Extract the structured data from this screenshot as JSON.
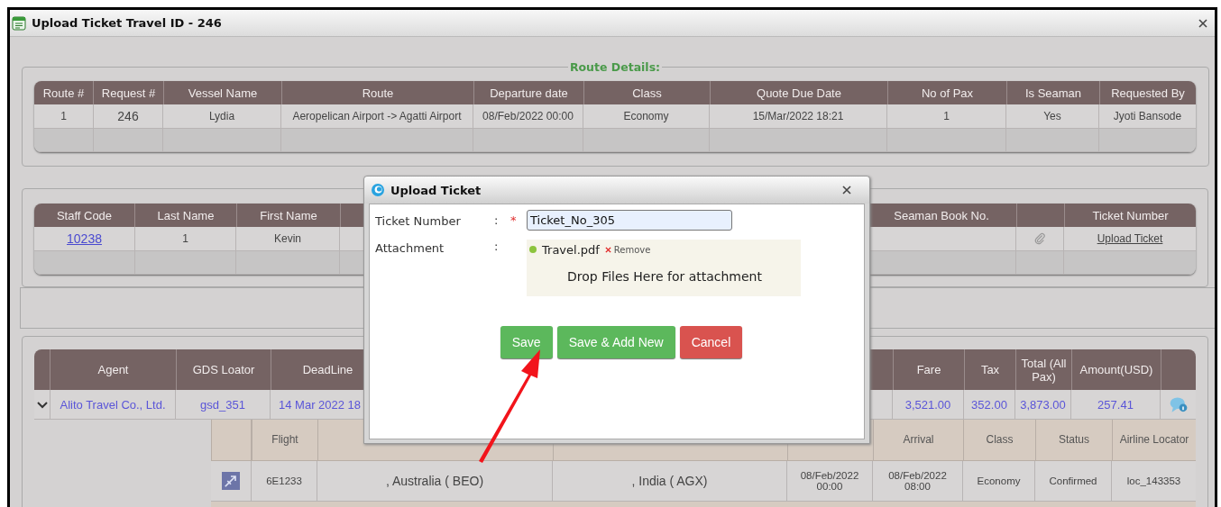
{
  "window": {
    "title": "Upload Ticket Travel ID - 246"
  },
  "route_details": {
    "legend": "Route Details:",
    "columns": [
      {
        "label": "Route #"
      },
      {
        "label": "Request #"
      },
      {
        "label": "Vessel Name"
      },
      {
        "label": "Route"
      },
      {
        "label": "Departure date"
      },
      {
        "label": "Class"
      },
      {
        "label": "Quote Due Date"
      },
      {
        "label": "No of Pax"
      },
      {
        "label": "Is Seaman"
      },
      {
        "label": "Requested By"
      }
    ],
    "rows": [
      [
        {
          "kind": "text",
          "text": "1"
        },
        {
          "kind": "text",
          "text": "246"
        },
        {
          "kind": "text",
          "text": "Lydia"
        },
        {
          "kind": "text",
          "text": "Aeropelican Airport -> Agatti Airport"
        },
        {
          "kind": "text",
          "text": "08/Feb/2022 00:00"
        },
        {
          "kind": "text",
          "text": "Economy"
        },
        {
          "kind": "text",
          "text": "15/Mar/2022 18:21"
        },
        {
          "kind": "text",
          "text": "1"
        },
        {
          "kind": "text",
          "text": "Yes"
        },
        {
          "kind": "text",
          "text": "Jyoti Bansode"
        }
      ]
    ]
  },
  "staff": {
    "columns": [
      {
        "label": "Staff Code"
      },
      {
        "label": "Last Name"
      },
      {
        "label": "First Name"
      },
      {},
      {
        "label": "Seaman Book No."
      },
      {},
      {
        "label": "Ticket Number"
      }
    ],
    "rows": [
      [
        {
          "kind": "link",
          "text": "10238"
        },
        {
          "kind": "text",
          "text": "1"
        },
        {
          "kind": "text",
          "text": "Kevin"
        },
        {},
        {},
        {
          "kind": "clip"
        },
        {
          "kind": "action",
          "text": "Upload Ticket"
        }
      ]
    ]
  },
  "quotes": {
    "columns": [
      {},
      {
        "label": "Agent"
      },
      {
        "label": "GDS Loator"
      },
      {
        "label": "DeadLine"
      },
      {},
      {
        "label": "Fare"
      },
      {
        "label": "Tax"
      },
      {
        "label": "Total (All Pax)"
      },
      {
        "label": "Amount(USD)"
      },
      {}
    ],
    "rows": [
      [
        {
          "kind": "toggle"
        },
        {
          "kind": "value",
          "text": "Alito Travel Co., Ltd."
        },
        {
          "kind": "value",
          "text": "gsd_351"
        },
        {
          "kind": "value",
          "text": "14 Mar 2022 18"
        },
        {},
        {
          "kind": "value",
          "text": "3,521.00"
        },
        {
          "kind": "value",
          "text": "352.00"
        },
        {
          "kind": "value",
          "text": "3,873.00"
        },
        {
          "kind": "value",
          "text": "257.41"
        },
        {
          "kind": "comment"
        }
      ]
    ],
    "segments": {
      "columns": [
        {},
        {
          "label": "Flight"
        },
        {},
        {},
        {},
        {
          "label": "Arrival"
        },
        {
          "label": "Class"
        },
        {
          "label": "Status"
        },
        {
          "label": "Airline Locator"
        }
      ],
      "rows": [
        [
          {
            "kind": "flight"
          },
          {
            "kind": "text",
            "text": "6E1233"
          },
          {
            "kind": "text",
            "text": ", Australia ( BEO)"
          },
          {
            "kind": "text",
            "text": ", India ( AGX)"
          },
          {
            "kind": "text",
            "text": "08/Feb/2022 00:00"
          },
          {
            "kind": "text",
            "text": "08/Feb/2022 08:00"
          },
          {
            "kind": "text",
            "text": "Economy"
          },
          {
            "kind": "text",
            "text": "Confirmed"
          },
          {
            "kind": "text",
            "text": "loc_143353"
          }
        ]
      ]
    }
  },
  "dialog": {
    "title": "Upload Ticket",
    "fields": [
      {
        "label": "Ticket Number",
        "colon": ":",
        "required_mark": "*",
        "value": "Ticket_No_305"
      }
    ],
    "attachment": {
      "label": "Attachment",
      "colon": ":",
      "file": "Travel.pdf",
      "remove": "Remove",
      "drop_hint": "Drop Files Here for attachment"
    },
    "buttons": [
      {
        "label": "Save",
        "kind": "primary"
      },
      {
        "label": "Save & Add New",
        "kind": "primary"
      },
      {
        "label": "Cancel",
        "kind": "danger"
      }
    ]
  }
}
